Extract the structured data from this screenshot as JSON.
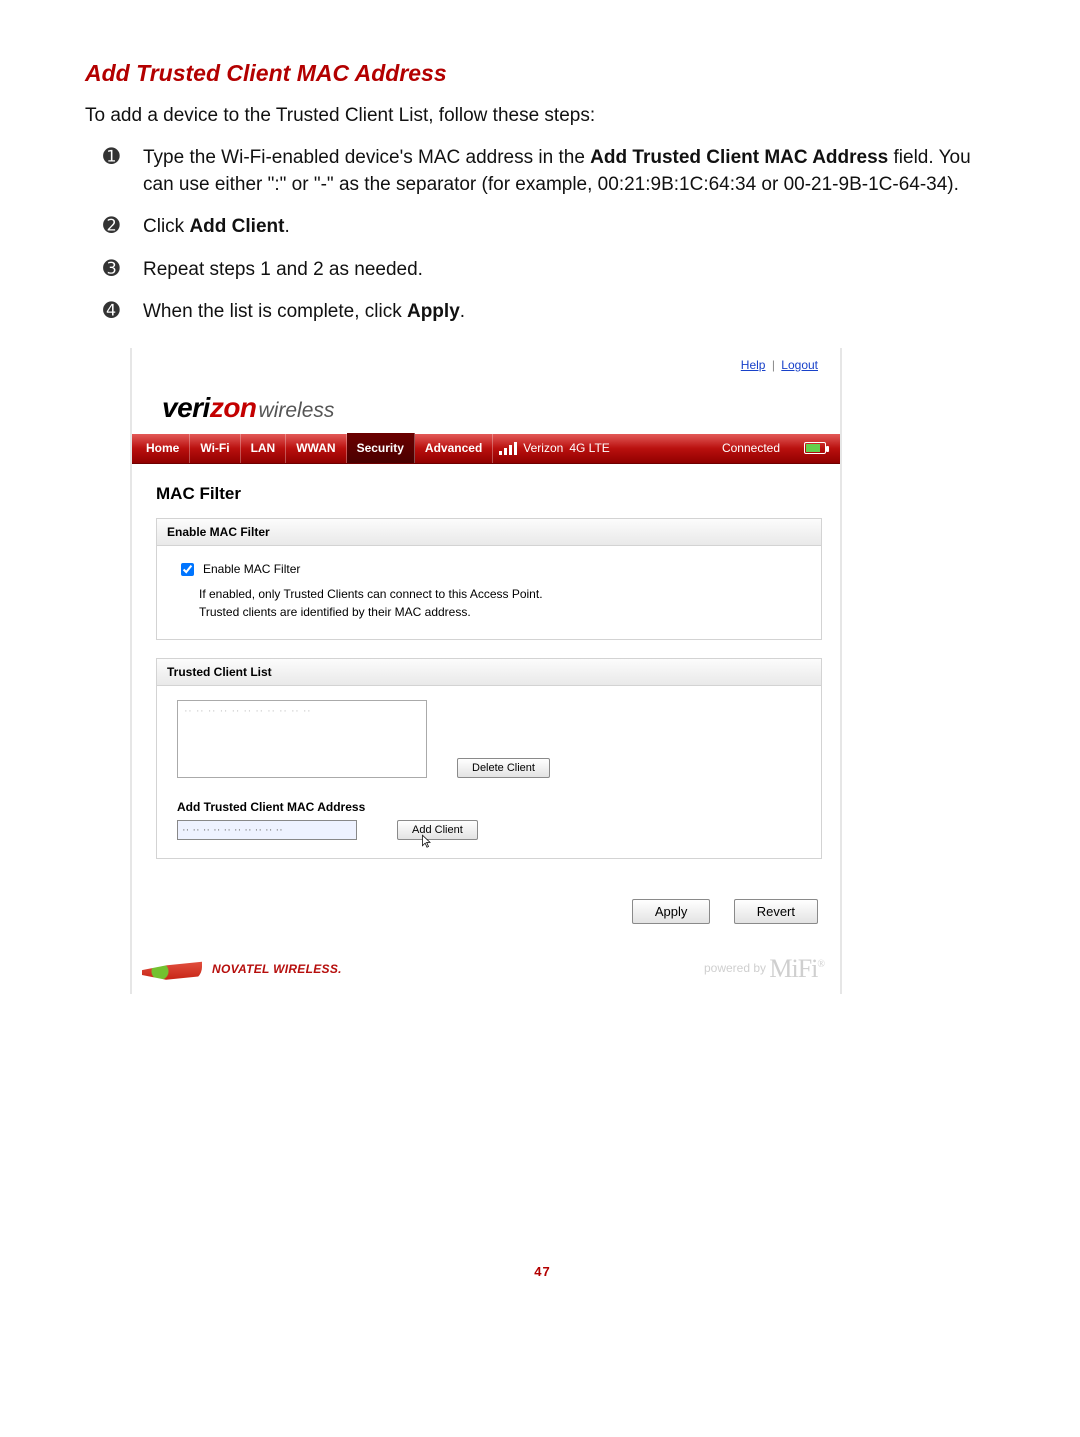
{
  "doc": {
    "section_title": "Add Trusted Client MAC Address",
    "intro": "To add a device to the Trusted Client List, follow these steps:",
    "steps": {
      "s1_pre": "Type the Wi-Fi-enabled device's MAC address in the ",
      "s1_b": "Add Trusted Client MAC Address",
      "s1_post": " field. You can use either \":\" or \"-\" as the separator (for example, 00:21:9B:1C:64:34 or 00-21-9B-1C-64-34).",
      "s2_pre": "Click ",
      "s2_b": "Add Client",
      "s2_post": ".",
      "s3": "Repeat steps 1 and 2 as needed.",
      "s4_pre": "When the list is complete, click ",
      "s4_b": "Apply",
      "s4_post": "."
    },
    "page_number": "47"
  },
  "markers": {
    "m1": "➊",
    "m2": "➋",
    "m3": "➌",
    "m4": "➍"
  },
  "ui": {
    "top": {
      "help": "Help",
      "logout": "Logout"
    },
    "brand": {
      "veri": "veri",
      "zon": "zon",
      "wireless": "wireless"
    },
    "nav": {
      "items": [
        "Home",
        "Wi-Fi",
        "LAN",
        "WWAN",
        "Security",
        "Advanced"
      ],
      "carrier": "Verizon",
      "tech": "4G LTE",
      "status": "Connected"
    },
    "panel": {
      "title": "MAC Filter",
      "group1": {
        "header": "Enable MAC Filter",
        "checkbox_label": "Enable MAC Filter",
        "hint_line1": "If enabled, only Trusted Clients can connect to this Access Point.",
        "hint_line2": "Trusted clients are identified by their MAC address."
      },
      "group2": {
        "header": "Trusted Client List",
        "list_placeholder": "·· ·· ·· ·· ·· ·· ·· ·· ·· ·· ··",
        "delete_btn": "Delete Client",
        "add_label": "Add Trusted Client MAC Address",
        "mac_placeholder": "·· ·· ·· ·· ·· ·· ·· ·· ·· ··",
        "add_btn": "Add Client"
      },
      "apply": "Apply",
      "revert": "Revert"
    },
    "footer": {
      "novatel": "NOVATEL WIRELESS.",
      "powered": "powered by",
      "mifi": "MiFi"
    }
  }
}
